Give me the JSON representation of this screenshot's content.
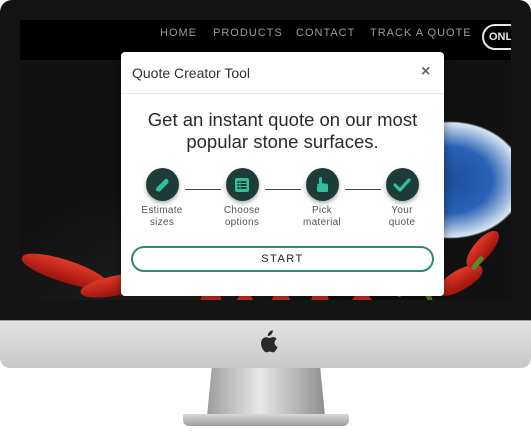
{
  "site": {
    "nav": [
      "HOME",
      "PRODUCTS",
      "CONTACT",
      "TRACK A QUOTE"
    ],
    "online_label": "ONL"
  },
  "modal": {
    "title": "Quote Creator Tool",
    "close_symbol": "×",
    "headline_line1": "Get an instant quote on our most",
    "headline_line2": "popular stone surfaces.",
    "steps": [
      {
        "line1": "Estimate",
        "line2": "sizes",
        "icon": "pencil-ruler-icon"
      },
      {
        "line1": "Choose",
        "line2": "options",
        "icon": "list-icon"
      },
      {
        "line1": "Pick",
        "line2": "material",
        "icon": "hand-pointer-icon"
      },
      {
        "line1": "Your",
        "line2": "quote",
        "icon": "checkmark-icon"
      }
    ],
    "start_label": "START"
  },
  "colors": {
    "step_circle": "#1e3c37",
    "step_icon": "#2fbf9c",
    "button_border": "#2e8a74"
  }
}
